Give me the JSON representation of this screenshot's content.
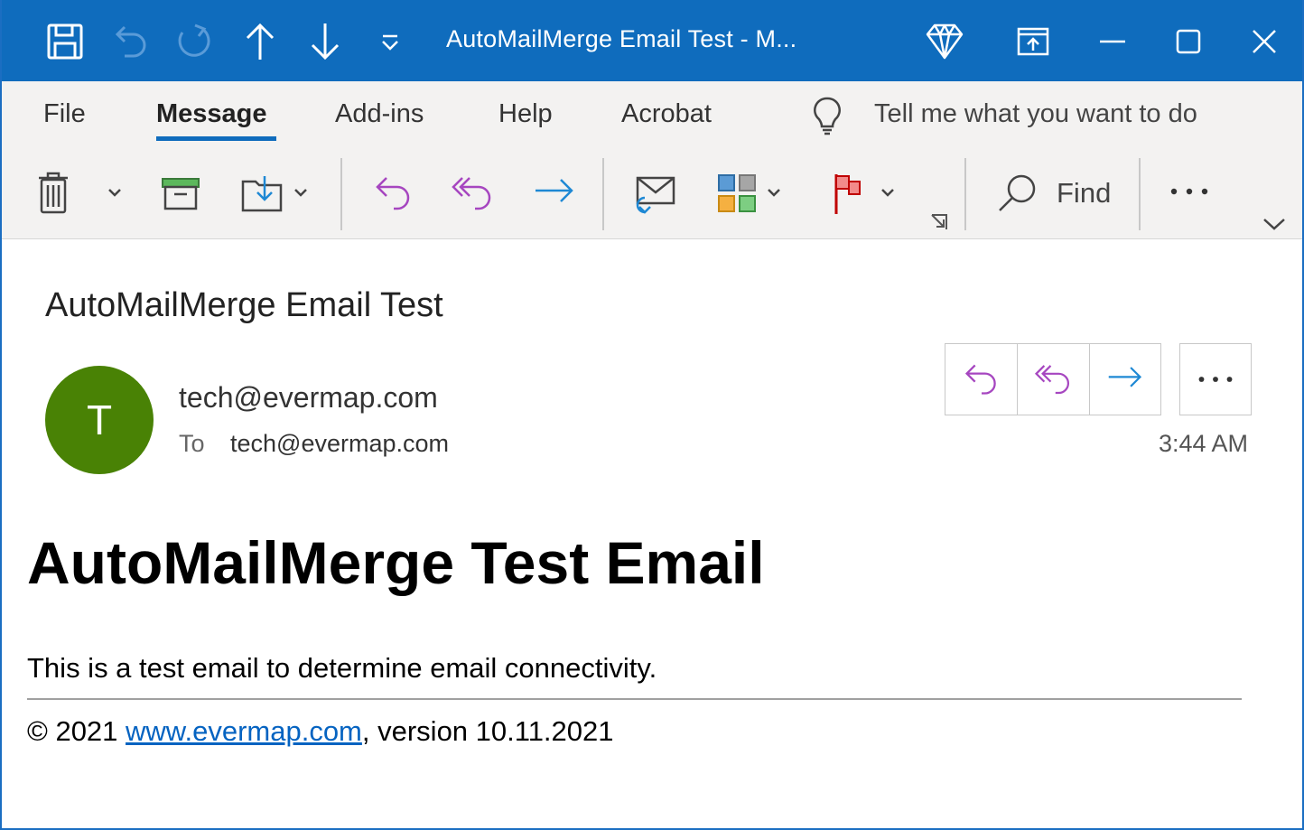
{
  "titlebar": {
    "title": "AutoMailMerge Email Test  -  M...",
    "icons": [
      "save-icon",
      "undo-icon",
      "redo-icon",
      "previous-item-icon",
      "next-item-icon",
      "customize-quick-access-icon",
      "diamond-premium-icon",
      "restore-window-icon",
      "minimize-icon",
      "maximize-icon",
      "close-icon"
    ]
  },
  "ribbon": {
    "tabs": [
      {
        "label": "File"
      },
      {
        "label": "Message"
      },
      {
        "label": "Add-ins"
      },
      {
        "label": "Help"
      },
      {
        "label": "Acrobat"
      }
    ],
    "active_tab": "Message",
    "tell_me": "Tell me what you want to do",
    "find_label": "Find"
  },
  "message": {
    "subject": "AutoMailMerge Email Test",
    "avatar_initial": "T",
    "from": "tech@evermap.com",
    "to_label": "To",
    "to_value": "tech@evermap.com",
    "time": "3:44 AM"
  },
  "body": {
    "heading": "AutoMailMerge Test Email",
    "paragraph": "This is a test email to determine email connectivity.",
    "footer_prefix": "© 2021 ",
    "footer_link": "www.evermap.com",
    "footer_suffix": ", version 10.11.2021"
  },
  "colors": {
    "accent": "#0f6cbd",
    "avatar": "#498205",
    "reply": "#a646c0",
    "forward": "#1e88d4",
    "link": "#0563c1"
  }
}
